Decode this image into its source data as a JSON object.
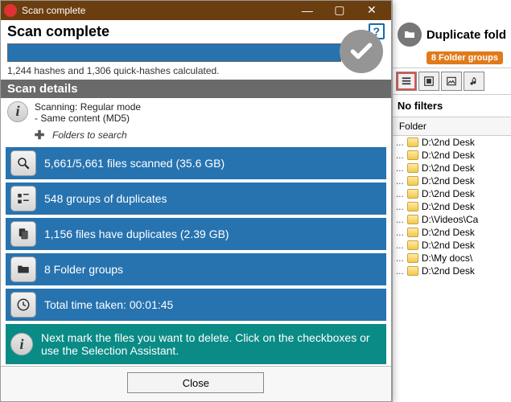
{
  "titlebar": {
    "title": "Scan complete"
  },
  "header": {
    "title": "Scan complete"
  },
  "progress_label": "1,244 hashes and 1,306 quick-hashes calculated.",
  "section_head": "Scan details",
  "info": {
    "line1": "Scanning: Regular mode",
    "line2": "- Same content (MD5)"
  },
  "folders_to_search": "Folders to search",
  "stats": {
    "scanned": "5,661/5,661 files scanned (35.6 GB)",
    "groups": "548 groups of duplicates",
    "dupfiles": "1,156 files have duplicates (2.39 GB)",
    "foldergroups": "8 Folder groups",
    "time": "Total time taken: 00:01:45",
    "hint": "Next mark the files you want to delete. Click on the checkboxes or use the Selection Assistant."
  },
  "close_label": "Close",
  "right": {
    "title": "Duplicate fold",
    "badge": "8 Folder groups",
    "nofilter": "No filters",
    "list_header": "Folder",
    "rows": [
      "D:\\2nd Desk",
      "D:\\2nd Desk",
      "D:\\2nd Desk",
      "D:\\2nd Desk",
      "D:\\2nd Desk",
      "D:\\2nd Desk",
      "D:\\Videos\\Ca",
      "D:\\2nd Desk",
      "D:\\2nd Desk",
      "D:\\My docs\\",
      "D:\\2nd Desk"
    ]
  }
}
